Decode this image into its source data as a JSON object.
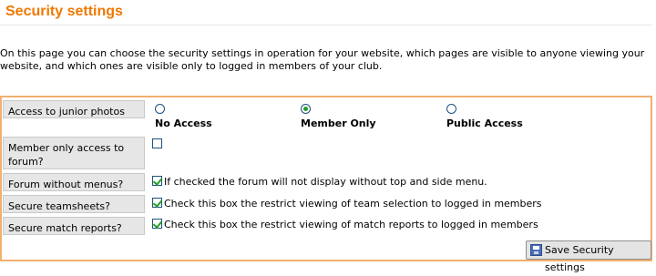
{
  "header": {
    "title": "Security settings"
  },
  "intro": "On this page you can choose the security settings in operation for your website, which pages are visible to anyone viewing your website, and which ones are visible only to logged in members of your club.",
  "settings": {
    "junior_photos": {
      "label": "Access to junior photos",
      "options": [
        {
          "label": "No Access",
          "selected": false
        },
        {
          "label": "Member Only",
          "selected": true
        },
        {
          "label": "Public Access",
          "selected": false
        }
      ]
    },
    "forum_member_only": {
      "label": "Member only access to forum?",
      "checked": false,
      "description": ""
    },
    "forum_without_menus": {
      "label": "Forum without menus?",
      "checked": true,
      "description": "If checked the forum will not display without top and side menu."
    },
    "secure_teamsheets": {
      "label": "Secure teamsheets?",
      "checked": true,
      "description": "Check this box the restrict viewing of team selection to logged in members"
    },
    "secure_match_reports": {
      "label": "Secure match reports?",
      "checked": true,
      "description": "Check this box the restrict viewing of match reports to logged in members"
    }
  },
  "actions": {
    "save_label": "Save Security settings"
  },
  "colors": {
    "title": "#f07800",
    "panel_border": "#f0b070",
    "label_bg": "#e6e6e6",
    "check": "#21a121"
  }
}
